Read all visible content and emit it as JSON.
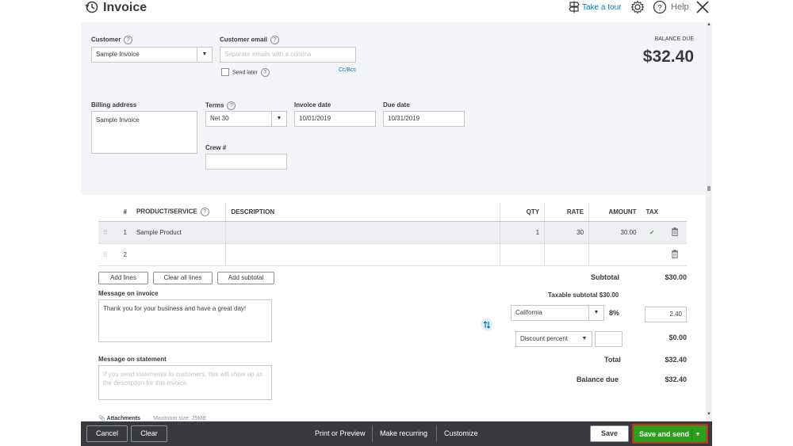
{
  "header": {
    "title": "Invoice",
    "take_tour": "Take a tour",
    "help": "Help"
  },
  "form": {
    "customer_label": "Customer",
    "customer_value": "Sample Invoice",
    "email_label": "Customer email",
    "email_placeholder": "Separate emails with a comma",
    "send_later_label": "Send later",
    "cc_bcc": "Cc/Bcc",
    "billing_label": "Billing address",
    "billing_value": "Sample Invoice",
    "terms_label": "Terms",
    "terms_value": "Net 30",
    "invoice_date_label": "Invoice date",
    "invoice_date_value": "10/01/2019",
    "due_date_label": "Due date",
    "due_date_value": "10/31/2019",
    "crew_label": "Crew #",
    "crew_value": "",
    "balance_due_label": "BALANCE DUE",
    "balance_due_value": "$32.40"
  },
  "table": {
    "columns": {
      "num": "#",
      "product": "PRODUCT/SERVICE",
      "description": "DESCRIPTION",
      "qty": "QTY",
      "rate": "RATE",
      "amount": "AMOUNT",
      "tax": "TAX"
    },
    "rows": [
      {
        "num": "1",
        "product": "Sample Product",
        "description": "",
        "qty": "1",
        "rate": "30",
        "amount": "30.00",
        "tax": "✓"
      },
      {
        "num": "2",
        "product": "",
        "description": "",
        "qty": "",
        "rate": "",
        "amount": "",
        "tax": ""
      }
    ]
  },
  "line_buttons": {
    "add_lines": "Add lines",
    "clear_all_lines": "Clear all lines",
    "add_subtotal": "Add subtotal"
  },
  "messages": {
    "invoice_label": "Message on invoice",
    "invoice_value": "Thank you for your business and have a great day!",
    "statement_label": "Message on statement",
    "statement_placeholder": "If you send statements to customers, this will show up as the description for this invoice.",
    "attachments_label": "Attachments",
    "max_size": "Maximum size: 25MB"
  },
  "totals": {
    "subtotal_label": "Subtotal",
    "subtotal_value": "$30.00",
    "taxable_subtotal": "Taxable subtotal $30.00",
    "tax_region": "California",
    "tax_rate": "8%",
    "tax_amount": "2.40",
    "discount_type": "Discount percent",
    "discount_input": "",
    "discount_value": "$0.00",
    "total_label": "Total",
    "total_value": "$32.40",
    "balance_label": "Balance due",
    "balance_value": "$32.40"
  },
  "footer": {
    "cancel": "Cancel",
    "clear": "Clear",
    "print_preview": "Print or Preview",
    "make_recurring": "Make recurring",
    "customize": "Customize",
    "save": "Save",
    "save_and_send": "Save and send"
  },
  "colors": {
    "accent_green": "#2ca01c",
    "link_blue": "#0077c5",
    "footer_bg": "#393a3d",
    "highlight_red": "#d52b1e"
  }
}
